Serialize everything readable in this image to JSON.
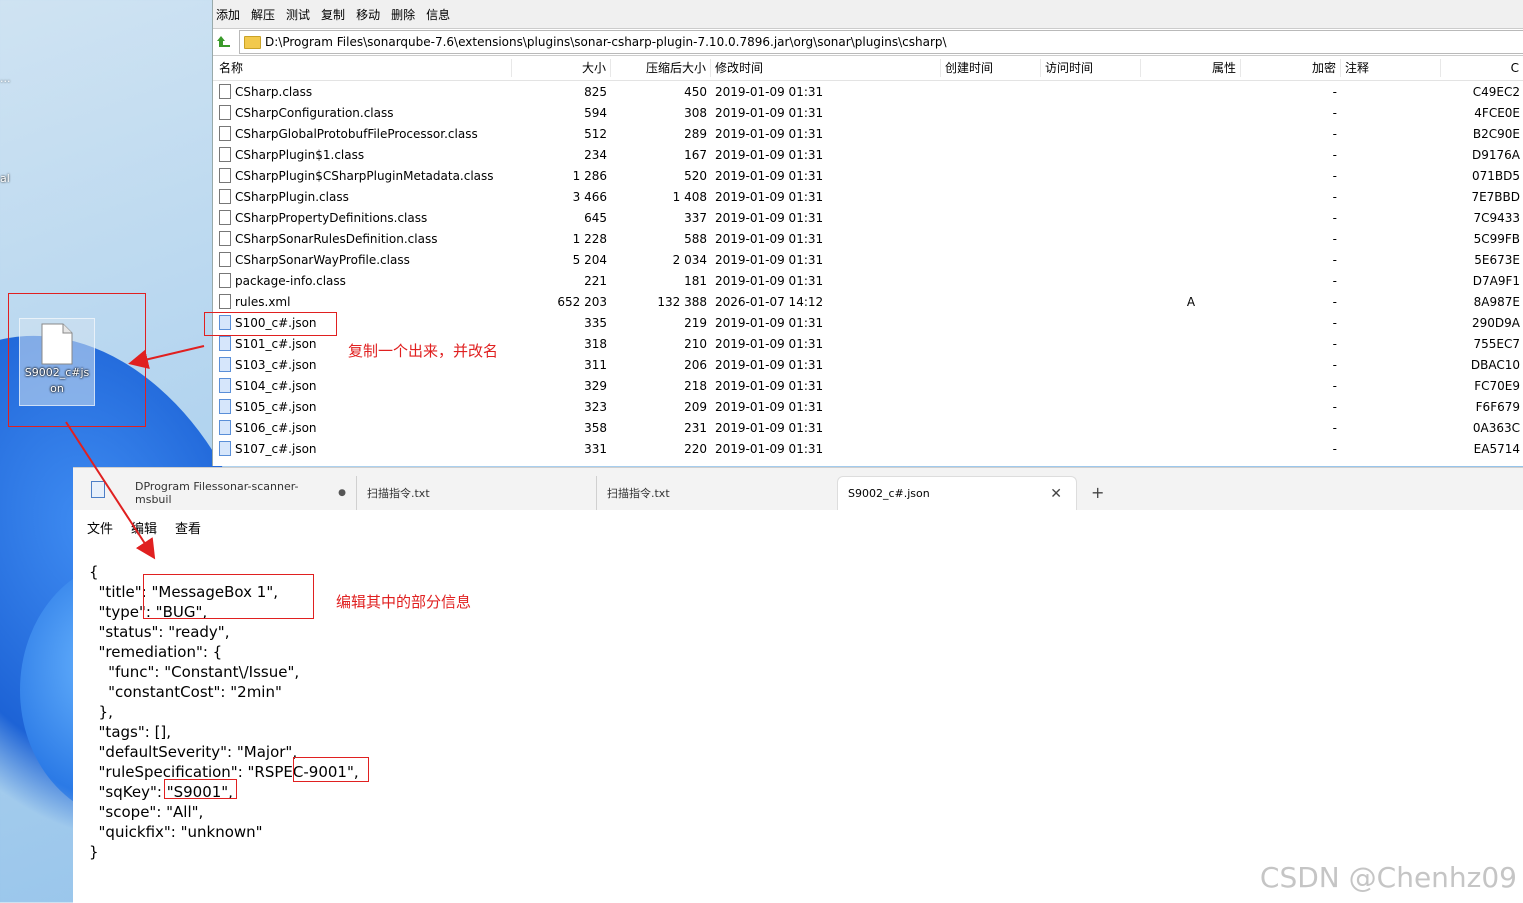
{
  "desktop": {
    "edge_labels": [
      "...",
      "al"
    ],
    "file_icon": {
      "label": "S9002_c#json"
    }
  },
  "archive": {
    "toolbar": [
      "添加",
      "解压",
      "测试",
      "复制",
      "移动",
      "删除",
      "信息"
    ],
    "path": "D:\\Program Files\\sonarqube-7.6\\extensions\\plugins\\sonar-csharp-plugin-7.10.0.7896.jar\\org\\sonar\\plugins\\csharp\\",
    "columns": [
      "名称",
      "大小",
      "压缩后大小",
      "修改时间",
      "创建时间",
      "访问时间",
      "属性",
      "加密",
      "注释",
      "C"
    ],
    "rows": [
      {
        "name": "CSharp.class",
        "size": "825",
        "psize": "450",
        "mod": "2019-01-09 01:31",
        "attr": "",
        "enc": "-",
        "crc": "C49EC2"
      },
      {
        "name": "CSharpConfiguration.class",
        "size": "594",
        "psize": "308",
        "mod": "2019-01-09 01:31",
        "attr": "",
        "enc": "-",
        "crc": "4FCE0E"
      },
      {
        "name": "CSharpGlobalProtobufFileProcessor.class",
        "size": "512",
        "psize": "289",
        "mod": "2019-01-09 01:31",
        "attr": "",
        "enc": "-",
        "crc": "B2C90E"
      },
      {
        "name": "CSharpPlugin$1.class",
        "size": "234",
        "psize": "167",
        "mod": "2019-01-09 01:31",
        "attr": "",
        "enc": "-",
        "crc": "D9176A"
      },
      {
        "name": "CSharpPlugin$CSharpPluginMetadata.class",
        "size": "1 286",
        "psize": "520",
        "mod": "2019-01-09 01:31",
        "attr": "",
        "enc": "-",
        "crc": "071BD5"
      },
      {
        "name": "CSharpPlugin.class",
        "size": "3 466",
        "psize": "1 408",
        "mod": "2019-01-09 01:31",
        "attr": "",
        "enc": "-",
        "crc": "7E7BBD"
      },
      {
        "name": "CSharpPropertyDefinitions.class",
        "size": "645",
        "psize": "337",
        "mod": "2019-01-09 01:31",
        "attr": "",
        "enc": "-",
        "crc": "7C9433"
      },
      {
        "name": "CSharpSonarRulesDefinition.class",
        "size": "1 228",
        "psize": "588",
        "mod": "2019-01-09 01:31",
        "attr": "",
        "enc": "-",
        "crc": "5C99FB"
      },
      {
        "name": "CSharpSonarWayProfile.class",
        "size": "5 204",
        "psize": "2 034",
        "mod": "2019-01-09 01:31",
        "attr": "",
        "enc": "-",
        "crc": "5E673E"
      },
      {
        "name": "package-info.class",
        "size": "221",
        "psize": "181",
        "mod": "2019-01-09 01:31",
        "attr": "",
        "enc": "-",
        "crc": "D7A9F1"
      },
      {
        "name": "rules.xml",
        "size": "652 203",
        "psize": "132 388",
        "mod": "2026-01-07 14:12",
        "attr": "A",
        "enc": "-",
        "crc": "8A987E"
      },
      {
        "name": "S100_c#.json",
        "size": "335",
        "psize": "219",
        "mod": "2019-01-09 01:31",
        "attr": "",
        "enc": "-",
        "crc": "290D9A"
      },
      {
        "name": "S101_c#.json",
        "size": "318",
        "psize": "210",
        "mod": "2019-01-09 01:31",
        "attr": "",
        "enc": "-",
        "crc": "755EC7"
      },
      {
        "name": "S103_c#.json",
        "size": "311",
        "psize": "206",
        "mod": "2019-01-09 01:31",
        "attr": "",
        "enc": "-",
        "crc": "DBAC10"
      },
      {
        "name": "S104_c#.json",
        "size": "329",
        "psize": "218",
        "mod": "2019-01-09 01:31",
        "attr": "",
        "enc": "-",
        "crc": "FC70E9"
      },
      {
        "name": "S105_c#.json",
        "size": "323",
        "psize": "209",
        "mod": "2019-01-09 01:31",
        "attr": "",
        "enc": "-",
        "crc": "F6F679"
      },
      {
        "name": "S106_c#.json",
        "size": "358",
        "psize": "231",
        "mod": "2019-01-09 01:31",
        "attr": "",
        "enc": "-",
        "crc": "0A363C"
      },
      {
        "name": "S107_c#.json",
        "size": "331",
        "psize": "220",
        "mod": "2019-01-09 01:31",
        "attr": "",
        "enc": "-",
        "crc": "EA5714"
      }
    ]
  },
  "notepad": {
    "tabs": [
      {
        "label": "DProgram Filessonar-scanner-msbuil",
        "modified": "●"
      },
      {
        "label": "扫描指令.txt"
      },
      {
        "label": "扫描指令.txt"
      },
      {
        "label": "S9002_c#.json",
        "close": "✕"
      }
    ],
    "new_tab": "+",
    "menu": [
      "文件",
      "编辑",
      "查看"
    ],
    "content": "{\n  \"title\": \"MessageBox 1\",\n  \"type\": \"BUG\",\n  \"status\": \"ready\",\n  \"remediation\": {\n    \"func\": \"Constant\\/Issue\",\n    \"constantCost\": \"2min\"\n  },\n  \"tags\": [],\n  \"defaultSeverity\": \"Major\",\n  \"ruleSpecification\": \"RSPEC-9001\",\n  \"sqKey\": \"S9001\",\n  \"scope\": \"All\",\n  \"quickfix\": \"unknown\"\n}"
  },
  "annotations": {
    "copy_note": "复制一个出来，并改名",
    "edit_note": "编辑其中的部分信息",
    "color": "#e02020"
  },
  "watermark": "CSDN @Chenhz09"
}
